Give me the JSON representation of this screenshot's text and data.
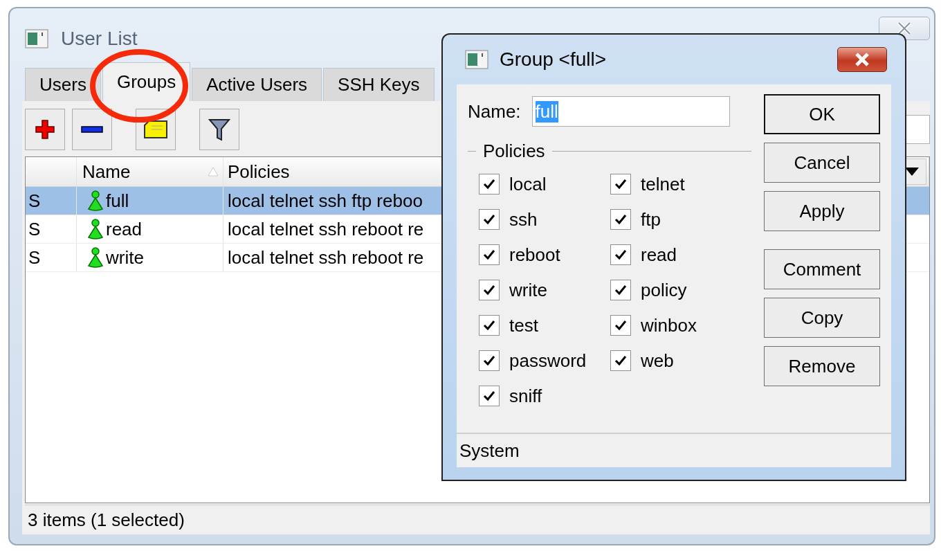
{
  "window": {
    "title": "User List"
  },
  "tabs": [
    {
      "label": "Users",
      "selected": false
    },
    {
      "label": "Groups",
      "selected": true
    },
    {
      "label": "Active Users",
      "selected": false
    },
    {
      "label": "SSH Keys",
      "selected": false
    }
  ],
  "table": {
    "columns": [
      "Name",
      "Policies"
    ],
    "rows": [
      {
        "flag": "S",
        "name": "full",
        "policies": "local telnet ssh ftp reboo",
        "selected": true
      },
      {
        "flag": "S",
        "name": "read",
        "policies": "local telnet ssh reboot re",
        "selected": false
      },
      {
        "flag": "S",
        "name": "write",
        "policies": "local telnet ssh reboot re",
        "selected": false
      }
    ]
  },
  "status_bar": "3 items (1 selected)",
  "dialog": {
    "title": "Group <full>",
    "name_label": "Name:",
    "name_value": "full",
    "group_label": "Policies",
    "policies": [
      {
        "label": "local",
        "checked": true
      },
      {
        "label": "telnet",
        "checked": true
      },
      {
        "label": "ssh",
        "checked": true
      },
      {
        "label": "ftp",
        "checked": true
      },
      {
        "label": "reboot",
        "checked": true
      },
      {
        "label": "read",
        "checked": true
      },
      {
        "label": "write",
        "checked": true
      },
      {
        "label": "policy",
        "checked": true
      },
      {
        "label": "test",
        "checked": true
      },
      {
        "label": "winbox",
        "checked": true
      },
      {
        "label": "password",
        "checked": true
      },
      {
        "label": "web",
        "checked": true
      },
      {
        "label": "sniff",
        "checked": true
      }
    ],
    "buttons": [
      {
        "label": "OK",
        "default": true
      },
      {
        "label": "Cancel",
        "default": false
      },
      {
        "label": "Apply",
        "default": false
      },
      {
        "label": "Comment",
        "default": false
      },
      {
        "label": "Copy",
        "default": false
      },
      {
        "label": "Remove",
        "default": false
      }
    ],
    "status": "System"
  }
}
